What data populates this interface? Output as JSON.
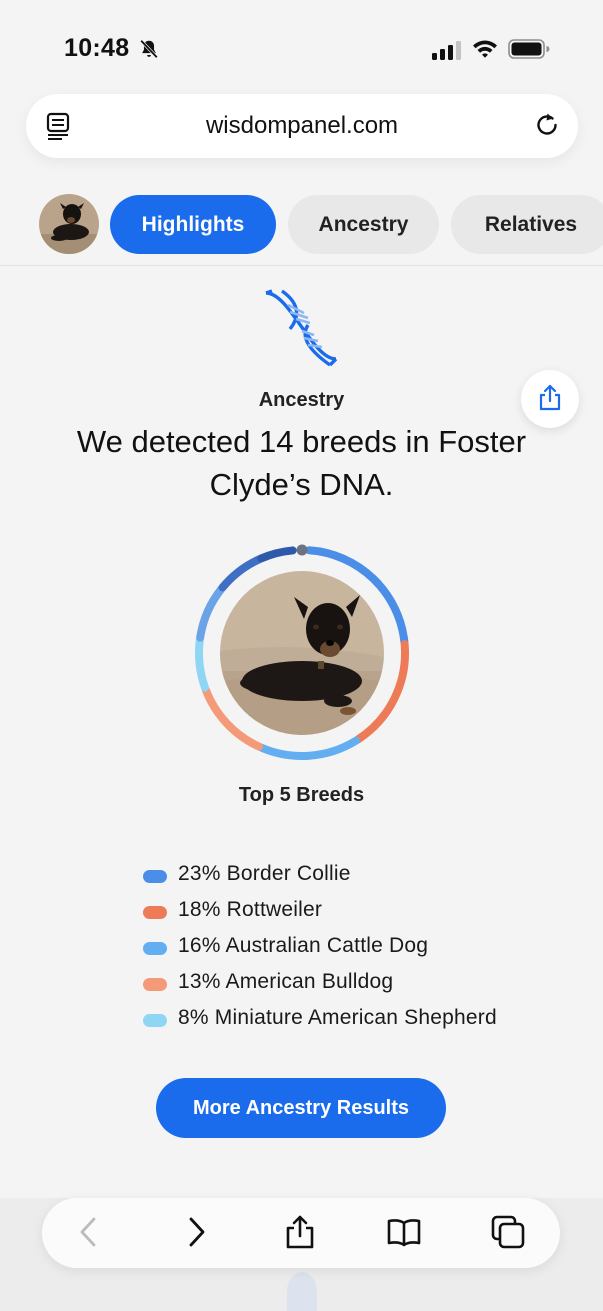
{
  "status_bar": {
    "time": "10:48",
    "icons": [
      "bell-slash-icon",
      "signal-icon",
      "wifi-icon",
      "battery-icon"
    ]
  },
  "browser": {
    "url": "wisdompanel.com",
    "icons": [
      "reader-mode-icon",
      "reload-icon"
    ]
  },
  "tabs": [
    {
      "label": "Highlights",
      "active": true
    },
    {
      "label": "Ancestry",
      "active": false
    },
    {
      "label": "Relatives",
      "active": false
    }
  ],
  "section": {
    "eyebrow": "Ancestry",
    "headline": "We detected 14 breeds in Foster Clyde’s DNA.",
    "chart_title": "Top 5 Breeds",
    "cta": "More Ancestry Results"
  },
  "breeds": [
    {
      "label": "23% Border Collie",
      "percent": 23,
      "color": "#4a8ee8"
    },
    {
      "label": "18% Rottweiler",
      "percent": 18,
      "color": "#ee7b57"
    },
    {
      "label": "16% Australian Cattle Dog",
      "percent": 16,
      "color": "#62aef0"
    },
    {
      "label": "13% American Bulldog",
      "percent": 13,
      "color": "#f49a78"
    },
    {
      "label": "8% Miniature American Shepherd",
      "percent": 8,
      "color": "#8fd6f4"
    }
  ],
  "colors": {
    "accent": "#1a6cec",
    "tab_inactive": "#e8e8e8",
    "background": "#f4f4f4"
  },
  "toolbar_icons": [
    "back-icon",
    "forward-icon",
    "share-icon",
    "bookmarks-icon",
    "tabs-icon"
  ]
}
